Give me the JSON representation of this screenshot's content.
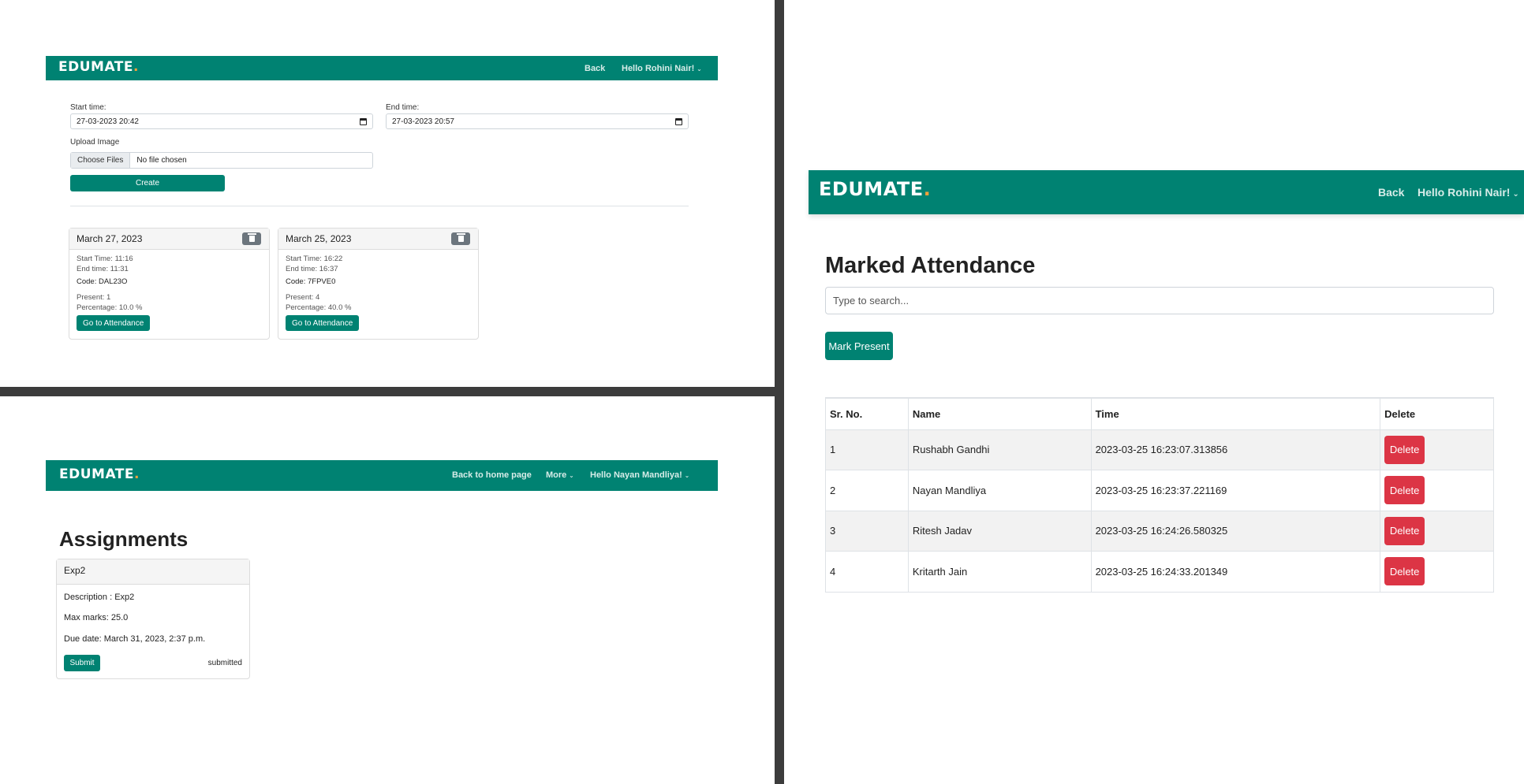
{
  "brand": {
    "name": "EDUMATE",
    "dot": "."
  },
  "panel1": {
    "nav": {
      "back": "Back",
      "greeting": "Hello Rohini Nair!"
    },
    "form": {
      "start_label": "Start time:",
      "start_value": "27-03-2023 20:42",
      "end_label": "End time:",
      "end_value": "27-03-2023 20:57",
      "upload_label": "Upload Image",
      "file_button": "Choose Files",
      "file_status": "No file chosen",
      "create_button": "Create"
    },
    "sessions": [
      {
        "date": "March 27, 2023",
        "start": "Start Time: 11:16",
        "end": "End time: 11:31",
        "code": "Code: DAL23O",
        "present": "Present: 1",
        "percentage": "Percentage: 10.0 %",
        "button": "Go to Attendance"
      },
      {
        "date": "March 25, 2023",
        "start": "Start Time: 16:22",
        "end": "End time: 16:37",
        "code": "Code: 7FPVE0",
        "present": "Present: 4",
        "percentage": "Percentage: 40.0 %",
        "button": "Go to Attendance"
      }
    ]
  },
  "panel2": {
    "nav": {
      "home": "Back to home page",
      "more": "More",
      "greeting": "Hello Nayan Mandliya!"
    },
    "title": "Assignments",
    "assignment": {
      "name": "Exp2",
      "description": "Description : Exp2",
      "max_marks": "Max marks: 25.0",
      "due": "Due date: March 31, 2023, 2:37 p.m.",
      "submit": "Submit",
      "status": "submitted"
    }
  },
  "panel3": {
    "nav": {
      "back": "Back",
      "greeting": "Hello Rohini Nair!"
    },
    "title": "Marked Attendance",
    "search_placeholder": "Type to search...",
    "mark_button": "Mark Present",
    "headers": [
      "Sr. No.",
      "Name",
      "Time",
      "Delete"
    ],
    "rows": [
      {
        "no": "1",
        "name": "Rushabh Gandhi",
        "time": "2023-03-25 16:23:07.313856",
        "action": "Delete"
      },
      {
        "no": "2",
        "name": "Nayan Mandliya",
        "time": "2023-03-25 16:23:37.221169",
        "action": "Delete"
      },
      {
        "no": "3",
        "name": "Ritesh Jadav",
        "time": "2023-03-25 16:24:26.580325",
        "action": "Delete"
      },
      {
        "no": "4",
        "name": "Kritarth Jain",
        "time": "2023-03-25 16:24:33.201349",
        "action": "Delete"
      }
    ]
  },
  "colors": {
    "primary": "#008272",
    "danger": "#dc3545",
    "secondary": "#6c757d",
    "brand_dot": "#f4a13a"
  }
}
